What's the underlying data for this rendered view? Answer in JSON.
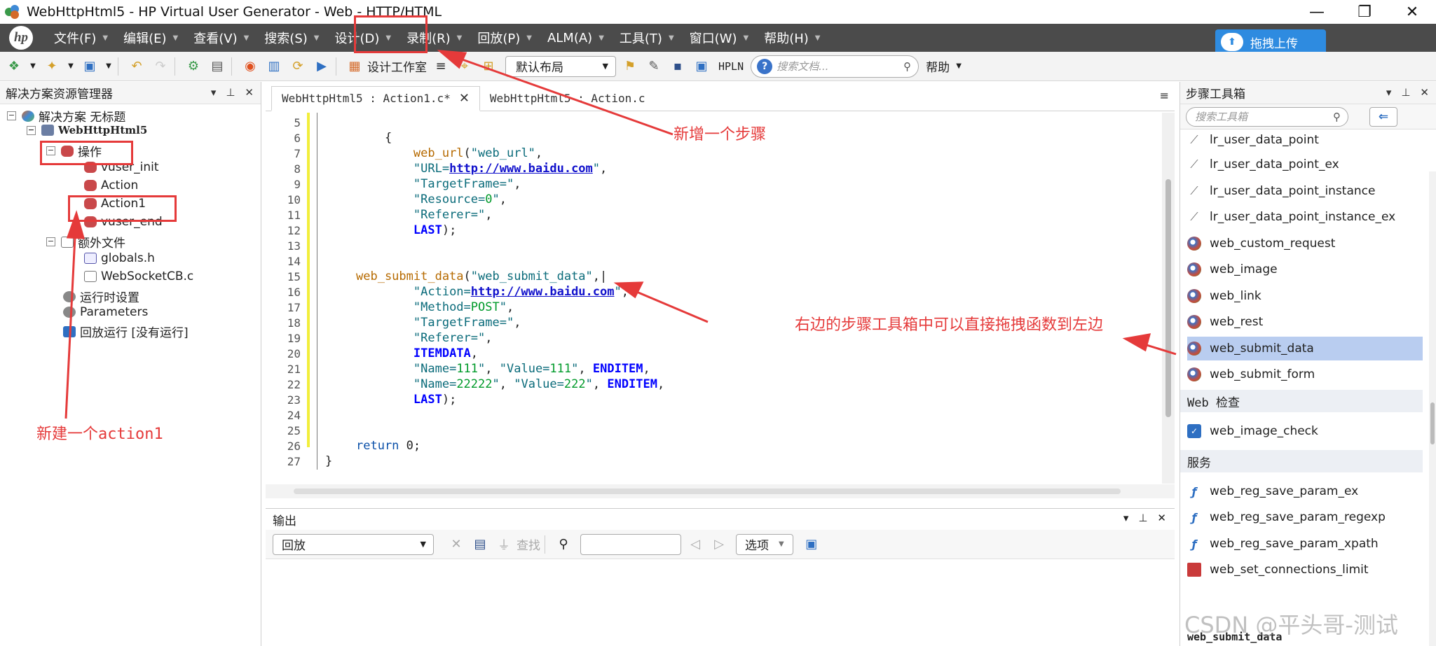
{
  "window": {
    "title": "WebHttpHtml5 - HP Virtual User Generator - Web - HTTP/HTML",
    "minimize": "—",
    "maximize": "❐",
    "close": "✕"
  },
  "menu": {
    "logo": "hp",
    "items": [
      "文件(F)",
      "编辑(E)",
      "查看(V)",
      "搜索(S)",
      "设计(D)",
      "录制(R)",
      "回放(P)",
      "ALM(A)",
      "工具(T)",
      "窗口(W)",
      "帮助(H)"
    ],
    "upload": "拖拽上传"
  },
  "toolbar": {
    "design_studio": "设计工作室",
    "layout": "默认布局",
    "hpln": "HPLN",
    "search_placeholder": "搜索文档...",
    "help": "帮助"
  },
  "solution_explorer": {
    "title": "解决方案资源管理器",
    "solution": "解决方案 无标题",
    "project": "WebHttpHtml5",
    "actions_folder": "操作",
    "actions": [
      "vuser_init",
      "Action",
      "Action1",
      "vuser_end"
    ],
    "extra_folder": "额外文件",
    "extra_files": [
      "globals.h",
      "WebSocketCB.c"
    ],
    "runtime": "运行时设置",
    "parameters": "Parameters",
    "replay": "回放运行 [没有运行]"
  },
  "editor": {
    "tabs": [
      "WebHttpHtml5 : Action1.c*",
      "WebHttpHtml5 : Action.c"
    ],
    "line_numbers": [
      "5",
      "6",
      "7",
      "8",
      "9",
      "10",
      "11",
      "12",
      "13",
      "14",
      "15",
      "16",
      "17",
      "18",
      "19",
      "20",
      "21",
      "22",
      "23",
      "24",
      "25",
      "26",
      "27"
    ]
  },
  "output": {
    "title": "输出",
    "replay_select": "回放",
    "find": "查找",
    "options": "选项"
  },
  "steps_toolbox": {
    "title": "步骤工具箱",
    "search_placeholder": "搜索工具箱",
    "lr_items": [
      "lr_user_data_point",
      "lr_user_data_point_ex",
      "lr_user_data_point_instance",
      "lr_user_data_point_instance_ex"
    ],
    "web_items": [
      "web_custom_request",
      "web_image",
      "web_link",
      "web_rest",
      "web_submit_data",
      "web_submit_form"
    ],
    "web_check_category": "Web 检查",
    "web_check_items": [
      "web_image_check"
    ],
    "service_category": "服务",
    "service_items": [
      "web_reg_save_param_ex",
      "web_reg_save_param_regexp",
      "web_reg_save_param_xpath",
      "web_set_connections_limit"
    ],
    "selected": "web_submit_data",
    "status": "web_submit_data"
  },
  "annotations": {
    "new_step": "新增一个步骤",
    "drag_hint": "右边的步骤工具箱中可以直接拖拽函数到左边",
    "new_action": "新建一个action1"
  },
  "watermark": "CSDN @平头哥-测试",
  "colors": {
    "menubar": "#4b4b4b",
    "annotation_red": "#e53a3a",
    "selection": "#b9cdf0"
  }
}
